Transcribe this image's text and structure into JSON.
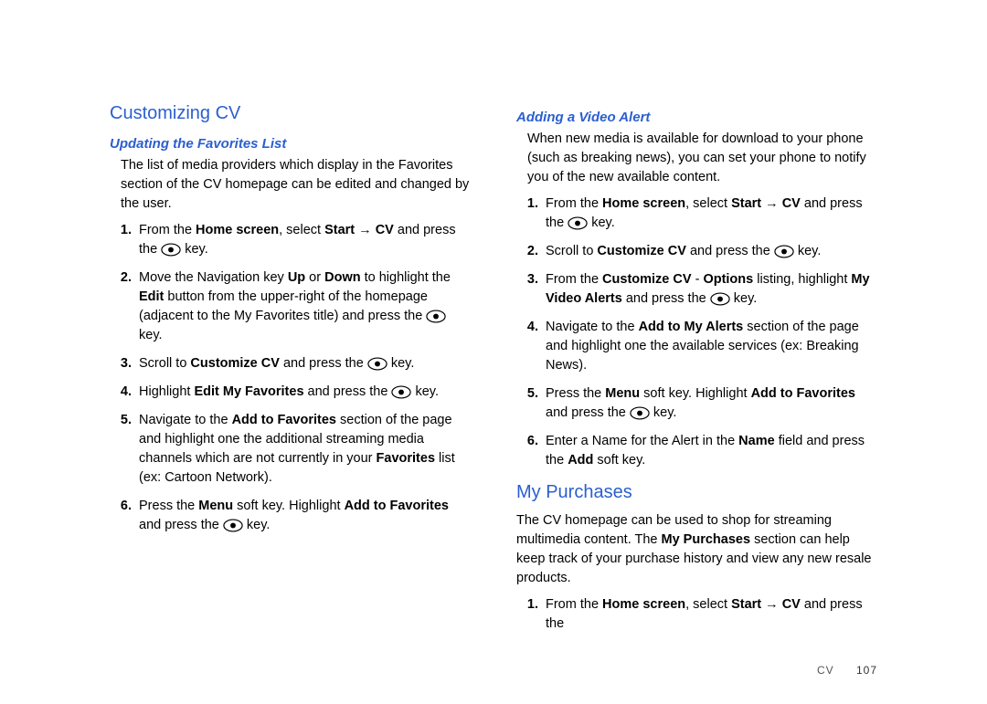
{
  "left": {
    "h1": "Customizing CV",
    "h2": "Updating the Favorites List",
    "intro": "The list of media providers which display in the Favorites section of the CV homepage can be edited and changed by the user.",
    "s1a": "From the ",
    "s1b": "Home screen",
    "s1c": ", select ",
    "s1d": "Start",
    "s1e": " → ",
    "s1f": "CV",
    "s1g": " and press the ",
    "s1h": " key.",
    "s2a": "Move the Navigation key ",
    "s2b": "Up",
    "s2c": " or ",
    "s2d": "Down",
    "s2e": " to highlight the ",
    "s2f": "Edit",
    "s2g": " button from the upper-right of the homepage (adjacent to the My Favorites title) and press the ",
    "s2h": " key.",
    "s3a": "Scroll to ",
    "s3b": "Customize CV",
    "s3c": " and press the ",
    "s3d": " key.",
    "s4a": "Highlight ",
    "s4b": "Edit My Favorites",
    "s4c": " and press the ",
    "s4d": " key.",
    "s5a": "Navigate to the ",
    "s5b": "Add to Favorites",
    "s5c": " section of the page and highlight one the additional streaming media channels which are not currently in your ",
    "s5d": "Favorites",
    "s5e": " list (ex: Cartoon Network).",
    "s6a": "Press the ",
    "s6b": "Menu",
    "s6c": " soft key. Highlight ",
    "s6d": "Add to Favorites",
    "s6e": " and press the ",
    "s6f": " key."
  },
  "right": {
    "h2": "Adding a Video Alert",
    "intro": "When new media is available for download to your phone (such as breaking news), you can set your phone to notify you of the new available content.",
    "s1a": "From the ",
    "s1b": "Home screen",
    "s1c": ", select ",
    "s1d": "Start",
    "s1e": " → ",
    "s1f": "CV",
    "s1g": " and press the ",
    "s1h": " key.",
    "s2a": "Scroll to ",
    "s2b": "Customize CV",
    "s2c": " and press the ",
    "s2d": " key.",
    "s3a": "From the ",
    "s3b": "Customize CV",
    "s3c": " - ",
    "s3d": "Options",
    "s3e": " listing, highlight ",
    "s3f": "My Video Alerts",
    "s3g": " and press the ",
    "s3h": " key.",
    "s4a": "Navigate to the ",
    "s4b": "Add to My Alerts",
    "s4c": " section of the page and highlight one the available services (ex: Breaking News).",
    "s5a": "Press the ",
    "s5b": "Menu",
    "s5c": " soft key. Highlight ",
    "s5d": "Add to Favorites",
    "s5e": " and press the ",
    "s5f": " key.",
    "s6a": "Enter a Name for the Alert in the ",
    "s6b": "Name",
    "s6c": " field and press the ",
    "s6d": "Add",
    "s6e": " soft key.",
    "h1b": "My Purchases",
    "p2a": "The CV homepage can be used to shop for streaming multimedia content. The ",
    "p2b": "My Purchases",
    "p2c": " section can help keep track of your purchase history and view any new resale products.",
    "b1a": "From the ",
    "b1b": "Home screen",
    "b1c": ", select ",
    "b1d": "Start",
    "b1e": " → ",
    "b1f": "CV",
    "b1g": " and press the"
  },
  "footer": {
    "section": "CV",
    "page": "107"
  }
}
